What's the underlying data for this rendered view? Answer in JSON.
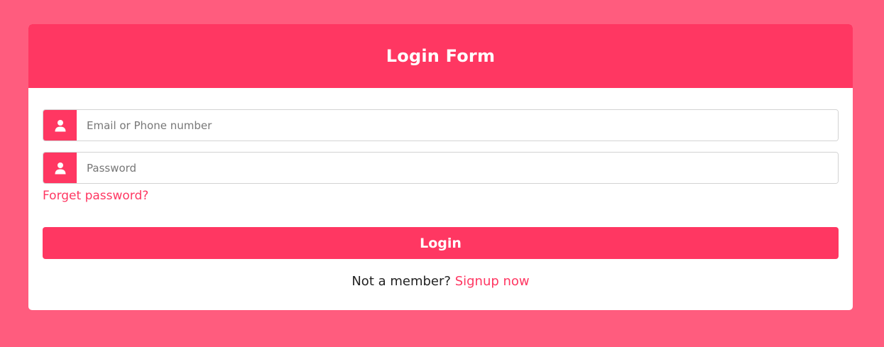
{
  "colors": {
    "page_background": "#FF5C7E",
    "accent": "#FF3762",
    "card_background": "#FFFFFF"
  },
  "form": {
    "title": "Login Form",
    "email": {
      "icon": "user-icon",
      "placeholder": "Email or Phone number",
      "value": ""
    },
    "password": {
      "icon": "user-icon",
      "placeholder": "Password",
      "value": ""
    },
    "forgot_label": "Forget password?",
    "login_label": "Login",
    "signup_prompt": "Not a member?",
    "signup_link": "Signup now"
  }
}
